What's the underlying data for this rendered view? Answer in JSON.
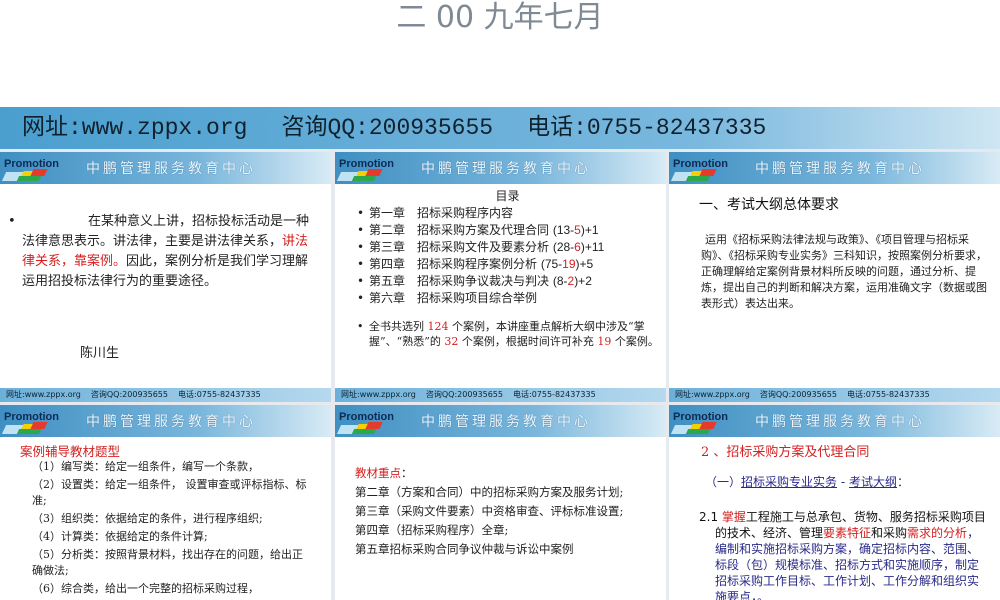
{
  "title": "二 00 九年七月",
  "banner": {
    "site": "网址:www.zppx.org",
    "qq": "咨询QQ:200935655",
    "phone": "电话:0755-82437335"
  },
  "panel_header": {
    "logo": "Promotion",
    "org": "中鹏管理服务教育中心"
  },
  "slide1": {
    "p1": "在某种意义上讲，招标投标活动是一种法律意思表示。讲法律，主要是讲法律关系，",
    "p_red": "讲法律关系，靠案例。",
    "p2": "因此，案例分析是我们学习理解运用招投标法律行为的重要途径。",
    "author": "陈川生"
  },
  "slide2": {
    "heading": "目录",
    "chapters": [
      {
        "name": "第一章　招标采购程序内容",
        "pre": "",
        "red": "",
        "post": ""
      },
      {
        "name": "第二章　招标采购方案及代理合同 ",
        "pre": "(13-",
        "red": "5",
        "post": ")+1"
      },
      {
        "name": "第三章　招标采购文件及要素分析 ",
        "pre": "(28-",
        "red": "6",
        "post": ")+11"
      },
      {
        "name": "第四章　招标采购程序案例分析 ",
        "pre": "(75-",
        "red": "19",
        "post": ")+5"
      },
      {
        "name": "第五章　招标采购争议裁决与判决 ",
        "pre": "(8-",
        "red": "2",
        "post": ")+2"
      },
      {
        "name": "第六章　招标采购项目综合举例",
        "pre": "",
        "red": "",
        "post": ""
      }
    ],
    "note": {
      "a": "全书共选列 ",
      "n1": "124",
      "b": " 个案例，本讲座重点解析大纲中涉及“掌握”、“熟悉”的 ",
      "n2": "32",
      "c": " 个案例，根据时间许可补充 ",
      "n3": "19",
      "d": " 个案例。"
    }
  },
  "slide3": {
    "heading": "一、考试大纲总体要求",
    "text": "运用《招标采购法律法规与政策》、《项目管理与招标采购》、《招标采购专业实务》三科知识，按照案例分析要求，正确理解给定案例背景材料所反映的问题，通过分析、提炼，提出自己的判断和解决方案，运用准确文字（数据或图表形式）表达出来。"
  },
  "slide4": {
    "heading": "案例辅导教材题型",
    "items": [
      "（1）编写类：给定一组条件，编写一个条款，",
      "（2）设置类：给定一组条件， 设置审查或评标指标、标准;",
      "（3）组织类：依据给定的条件，进行程序组织;",
      "（4）计算类：依据给定的条件计算;",
      "（5）分析类：按照背景材料，找出存在的问题，给出正确做法;",
      "（6）综合类，给出一个完整的招标采购过程，"
    ]
  },
  "slide5": {
    "heading": "教材重点",
    "colon": "：",
    "items": [
      "第二章（方案和合同）中的招标采购方案及服务计划;",
      "第三章（采购文件要素）中资格审查、评标标准设置;",
      "第四章（招标采购程序）全章;",
      "第五章招标采购合同争议仲裁与诉讼中案例"
    ]
  },
  "slide6": {
    "heading": "2 、招标采购方案及代理合同",
    "sub_prefix": "（一）",
    "link1": "招标采购专业实务",
    "dash": " - ",
    "link2": "考试大纲",
    "sub_suffix": "：",
    "p_num": "2.1 ",
    "p_red1": "掌握",
    "p_a": "工程施工与总承包、货物、服务招标采购项目的技术、经济、管理",
    "p_red2": "要素特征",
    "p_b": "和采购",
    "p_red3": "需求的分析",
    "p_c": "，编制和实施招标采购方案，确定招标内容、范围、标段（包）规模标准、招标方式和实施顺序，制定招标采购工作目标、工作计划、工作分解和组织实施要点，。"
  }
}
